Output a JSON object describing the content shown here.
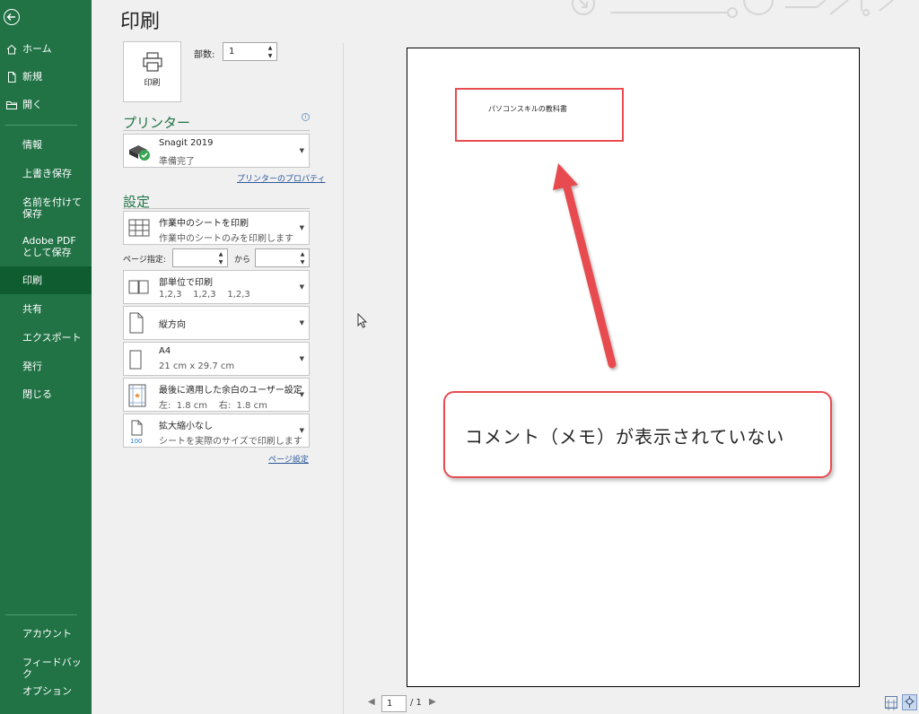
{
  "sidebar": {
    "items": [
      {
        "label": "ホーム",
        "icon": "home-icon"
      },
      {
        "label": "新規",
        "icon": "new-file-icon"
      },
      {
        "label": "開く",
        "icon": "open-folder-icon"
      },
      {
        "label": "情報"
      },
      {
        "label": "上書き保存"
      },
      {
        "label": "名前を付けて保存"
      },
      {
        "label": "Adobe PDF として保存"
      },
      {
        "label": "印刷"
      },
      {
        "label": "共有"
      },
      {
        "label": "エクスポート"
      },
      {
        "label": "発行"
      },
      {
        "label": "閉じる"
      },
      {
        "label": "アカウント"
      },
      {
        "label": "フィードバック"
      },
      {
        "label": "オプション"
      }
    ],
    "active_color": "#0e5c2f",
    "bg_color": "#217346"
  },
  "page_title": "印刷",
  "print_button_label": "印刷",
  "copies": {
    "label": "部数:",
    "value": "1"
  },
  "printer": {
    "heading": "プリンター",
    "name": "Snagit 2019",
    "status": "準備完了",
    "properties_link": "プリンターのプロパティ"
  },
  "settings": {
    "heading": "設定",
    "scope": {
      "title": "作業中のシートを印刷",
      "sub": "作業中のシートのみを印刷します"
    },
    "pages": {
      "label": "ページ指定:",
      "to": "から"
    },
    "collate": {
      "title": "部単位で印刷",
      "sub": "1,2,3    1,2,3    1,2,3"
    },
    "orientation": {
      "title": "縦方向"
    },
    "paper": {
      "title": "A4",
      "sub": "21 cm x 29.7 cm"
    },
    "margins": {
      "title": "最後に適用した余白のユーザー設定",
      "sub": "左:  1.8 cm    右:  1.8 cm"
    },
    "scaling": {
      "title": "拡大縮小なし",
      "sub": "シートを実際のサイズで印刷します",
      "icon_text": "100"
    },
    "page_setup_link": "ページ設定"
  },
  "preview": {
    "page_text": "パソコンスキルの教科書",
    "callout": "コメント（メモ）が表示されていない",
    "annotation_color": "#e84b50"
  },
  "navigation": {
    "current_page": "1",
    "total": "/ 1"
  }
}
